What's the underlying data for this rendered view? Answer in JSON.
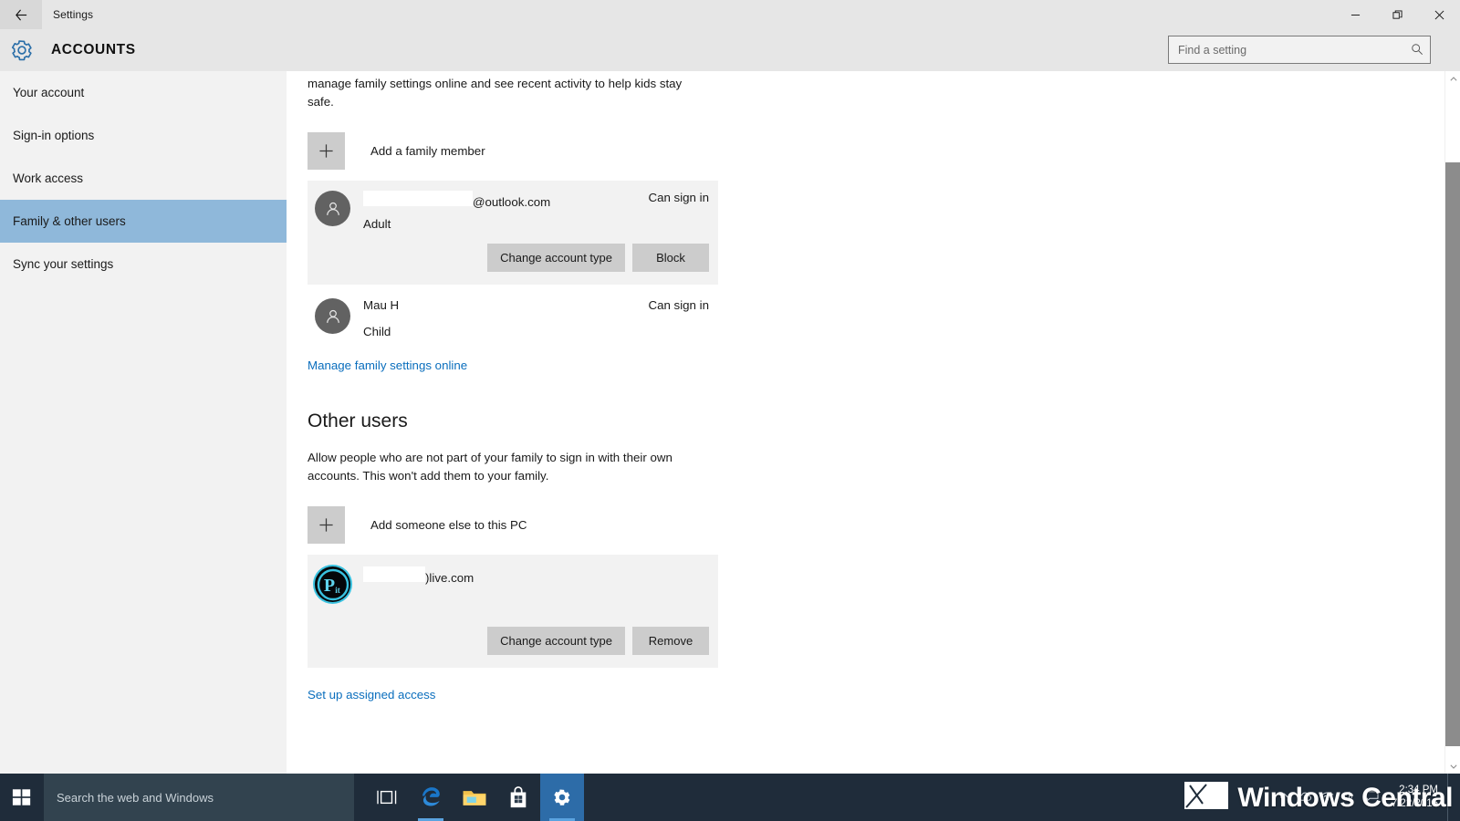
{
  "window": {
    "title": "Settings",
    "back_icon": "back-arrow-icon",
    "minimize_label": "—",
    "maximize_label": "❐",
    "close_label": "✕"
  },
  "header": {
    "icon": "gear-icon",
    "title": "ACCOUNTS"
  },
  "search": {
    "placeholder": "Find a setting",
    "value": "",
    "icon": "search-icon"
  },
  "sidebar": {
    "items": [
      {
        "label": "Your account",
        "selected": false
      },
      {
        "label": "Sign-in options",
        "selected": false
      },
      {
        "label": "Work access",
        "selected": false
      },
      {
        "label": "Family & other users",
        "selected": true
      },
      {
        "label": "Sync your settings",
        "selected": false
      }
    ]
  },
  "main": {
    "family_intro": "manage family settings online and see recent activity to help kids stay safe.",
    "add_family_member": {
      "label": "Add a family member",
      "icon": "plus-icon"
    },
    "family_accounts": [
      {
        "email_suffix": "@outlook.com",
        "redacted": true,
        "account_type": "Adult",
        "status": "Can sign in",
        "avatar": "person-avatar-icon",
        "buttons": [
          "Change account type",
          "Block"
        ]
      },
      {
        "email_suffix": "Mau H",
        "redacted": false,
        "account_type": "Child",
        "status": "Can sign in",
        "avatar": "person-avatar-icon",
        "buttons": []
      }
    ],
    "manage_family_link": "Manage family settings online",
    "other_users_heading": "Other users",
    "other_users_desc": "Allow people who are not part of your family to sign in with their own accounts. This won't add them to your family.",
    "add_someone": {
      "label": "Add someone else to this PC",
      "icon": "plus-icon"
    },
    "other_accounts": [
      {
        "email_suffix": ")live.com",
        "redacted": true,
        "avatar": "pit-logo-avatar-icon",
        "avatar_text_main": "P",
        "avatar_text_sub": "it",
        "buttons": [
          "Change account type",
          "Remove"
        ]
      }
    ],
    "assigned_access_link": "Set up assigned access"
  },
  "scrollbar": {
    "up_arrow": "chevron-up-icon",
    "down_arrow": "chevron-down-icon"
  },
  "taskbar": {
    "start_icon": "windows-start-icon",
    "search_placeholder": "Search the web and Windows",
    "icons": [
      {
        "name": "task-view-icon",
        "glyph": "[□]",
        "active": false,
        "running": false
      },
      {
        "name": "edge-browser-icon",
        "glyph": "e",
        "active": false,
        "running": true
      },
      {
        "name": "file-explorer-icon",
        "glyph": "folder",
        "active": false,
        "running": false
      },
      {
        "name": "store-icon",
        "glyph": "bag",
        "active": false,
        "running": false
      },
      {
        "name": "settings-icon",
        "glyph": "gear",
        "active": true,
        "running": true
      }
    ],
    "tray": {
      "show_hidden_icon": "chevron-up-icon",
      "onedrive_icon": "cloud-icon",
      "network_icon": "wifi-icon",
      "volume_icon": "speaker-icon",
      "action_center_icon": "notification-icon",
      "time": "2:34 PM",
      "date": "7/22/2015"
    }
  },
  "watermark": {
    "text": "Windows Central",
    "logo": "windows-central-logo-icon"
  },
  "colors": {
    "accent": "#0a6ebd",
    "selection": "#8fb8da",
    "chrome": "#e6e6e6",
    "sidebar": "#f2f2f2",
    "card": "#f2f2f2",
    "button": "#cccccc",
    "taskbar": "#1f2c3a",
    "avatar_ring": "#39c2e0"
  }
}
